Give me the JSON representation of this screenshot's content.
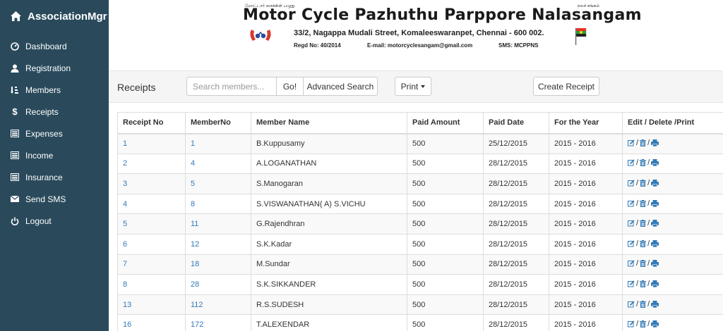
{
  "sidebar": {
    "brand": "AssociationMgr",
    "items": [
      {
        "label": "Dashboard",
        "icon": "dashboard-icon"
      },
      {
        "label": "Registration",
        "icon": "user-icon"
      },
      {
        "label": "Members",
        "icon": "sort-icon"
      },
      {
        "label": "Receipts",
        "icon": "dollar-icon"
      },
      {
        "label": "Expenses",
        "icon": "list-icon"
      },
      {
        "label": "Income",
        "icon": "list-icon"
      },
      {
        "label": "Insurance",
        "icon": "list-icon"
      },
      {
        "label": "Send SMS",
        "icon": "envelope-icon"
      },
      {
        "label": "Logout",
        "icon": "power-icon"
      }
    ]
  },
  "header": {
    "tamil_left": "மோட்டார் சைக்கிள் பழுது",
    "tamil_right": "நலச் சங்கம்",
    "title": "Motor Cycle Pazhuthu Parppore Nalasangam",
    "address": "33/2, Nagappa Mudali Street, Komaleeswaranpet, Chennai - 600 002.",
    "regd": "Regd No: 40/2014",
    "email": "E-mail: motorcyclesangam@gmail.com",
    "sms": "SMS: MCPPNS"
  },
  "toolbar": {
    "title": "Receipts",
    "search_placeholder": "Search members...",
    "go_label": "Go!",
    "advanced_label": "Advanced Search",
    "print_label": "Print",
    "create_label": "Create Receipt"
  },
  "table": {
    "headers": [
      "Receipt No",
      "MemberNo",
      "Member Name",
      "Paid Amount",
      "Paid Date",
      "For the Year",
      "Edit / Delete /Print"
    ],
    "rows": [
      {
        "receipt": "1",
        "member": "1",
        "name": "B.Kuppusamy",
        "amount": "500",
        "date": "25/12/2015",
        "year": "2015 - 2016"
      },
      {
        "receipt": "2",
        "member": "4",
        "name": "A.LOGANATHAN",
        "amount": "500",
        "date": "28/12/2015",
        "year": "2015 - 2016"
      },
      {
        "receipt": "3",
        "member": "5",
        "name": "S.Manogaran",
        "amount": "500",
        "date": "28/12/2015",
        "year": "2015 - 2016"
      },
      {
        "receipt": "4",
        "member": "8",
        "name": "S.VISWANATHAN( A) S.VICHU",
        "amount": "500",
        "date": "28/12/2015",
        "year": "2015 - 2016"
      },
      {
        "receipt": "5",
        "member": "11",
        "name": "G.Rajendhran",
        "amount": "500",
        "date": "28/12/2015",
        "year": "2015 - 2016"
      },
      {
        "receipt": "6",
        "member": "12",
        "name": "S.K.Kadar",
        "amount": "500",
        "date": "28/12/2015",
        "year": "2015 - 2016"
      },
      {
        "receipt": "7",
        "member": "18",
        "name": "M.Sundar",
        "amount": "500",
        "date": "28/12/2015",
        "year": "2015 - 2016"
      },
      {
        "receipt": "8",
        "member": "28",
        "name": "S.K.SIKKANDER",
        "amount": "500",
        "date": "28/12/2015",
        "year": "2015 - 2016"
      },
      {
        "receipt": "13",
        "member": "112",
        "name": "R.S.SUDESH",
        "amount": "500",
        "date": "28/12/2015",
        "year": "2015 - 2016"
      },
      {
        "receipt": "16",
        "member": "172",
        "name": "T.ALEXENDAR",
        "amount": "500",
        "date": "28/12/2015",
        "year": "2015 - 2016"
      }
    ]
  },
  "colors": {
    "sidebar_bg": "#2a4a5c",
    "link": "#337ab7"
  }
}
